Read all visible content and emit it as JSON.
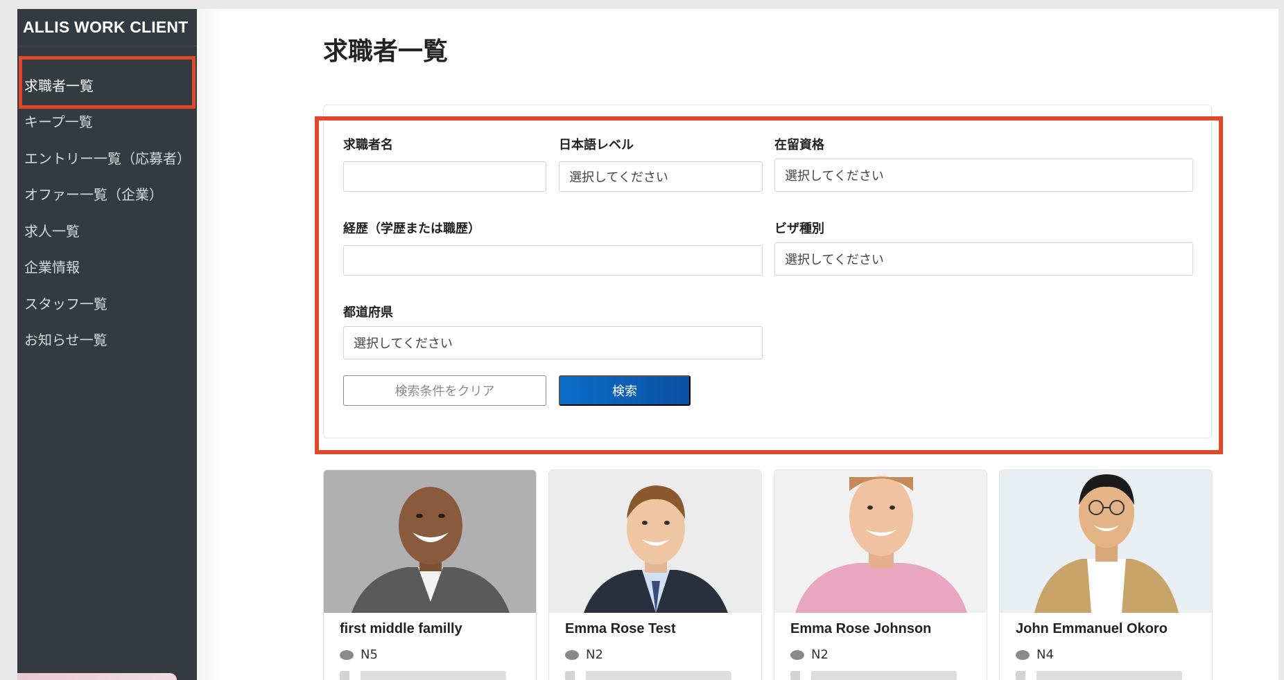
{
  "app": {
    "brand": "ALLIS WORK CLIENT"
  },
  "sidebar": {
    "items": [
      {
        "label": "求職者一覧"
      },
      {
        "label": "キープ一覧"
      },
      {
        "label": "エントリー一覧（応募者）"
      },
      {
        "label": "オファー一覧（企業）"
      },
      {
        "label": "求人一覧"
      },
      {
        "label": "企業情報"
      },
      {
        "label": "スタッフ一覧"
      },
      {
        "label": "お知らせ一覧"
      }
    ]
  },
  "page": {
    "title": "求職者一覧"
  },
  "search": {
    "name_label": "求職者名",
    "name_value": "",
    "japanese_level_label": "日本語レベル",
    "japanese_level_value": "選択してください",
    "residence_status_label": "在留資格",
    "residence_status_value": "選択してください",
    "career_label": "経歴（学歴または職歴）",
    "career_value": "",
    "visa_type_label": "ビザ種別",
    "visa_type_value": "選択してください",
    "prefecture_label": "都道府県",
    "prefecture_value": "選択してください",
    "clear_button": "検索条件をクリア",
    "search_button": "検索"
  },
  "candidates": [
    {
      "name": "first middle familly",
      "level": "N5"
    },
    {
      "name": "Emma Rose Test",
      "level": "N2"
    },
    {
      "name": "Emma Rose Johnson",
      "level": "N2"
    },
    {
      "name": "John Emmanuel Okoro",
      "level": "N4"
    }
  ],
  "colors": {
    "sidebar_bg": "#343a40",
    "highlight": "#e0482a",
    "primary": "#0a5fb5"
  }
}
